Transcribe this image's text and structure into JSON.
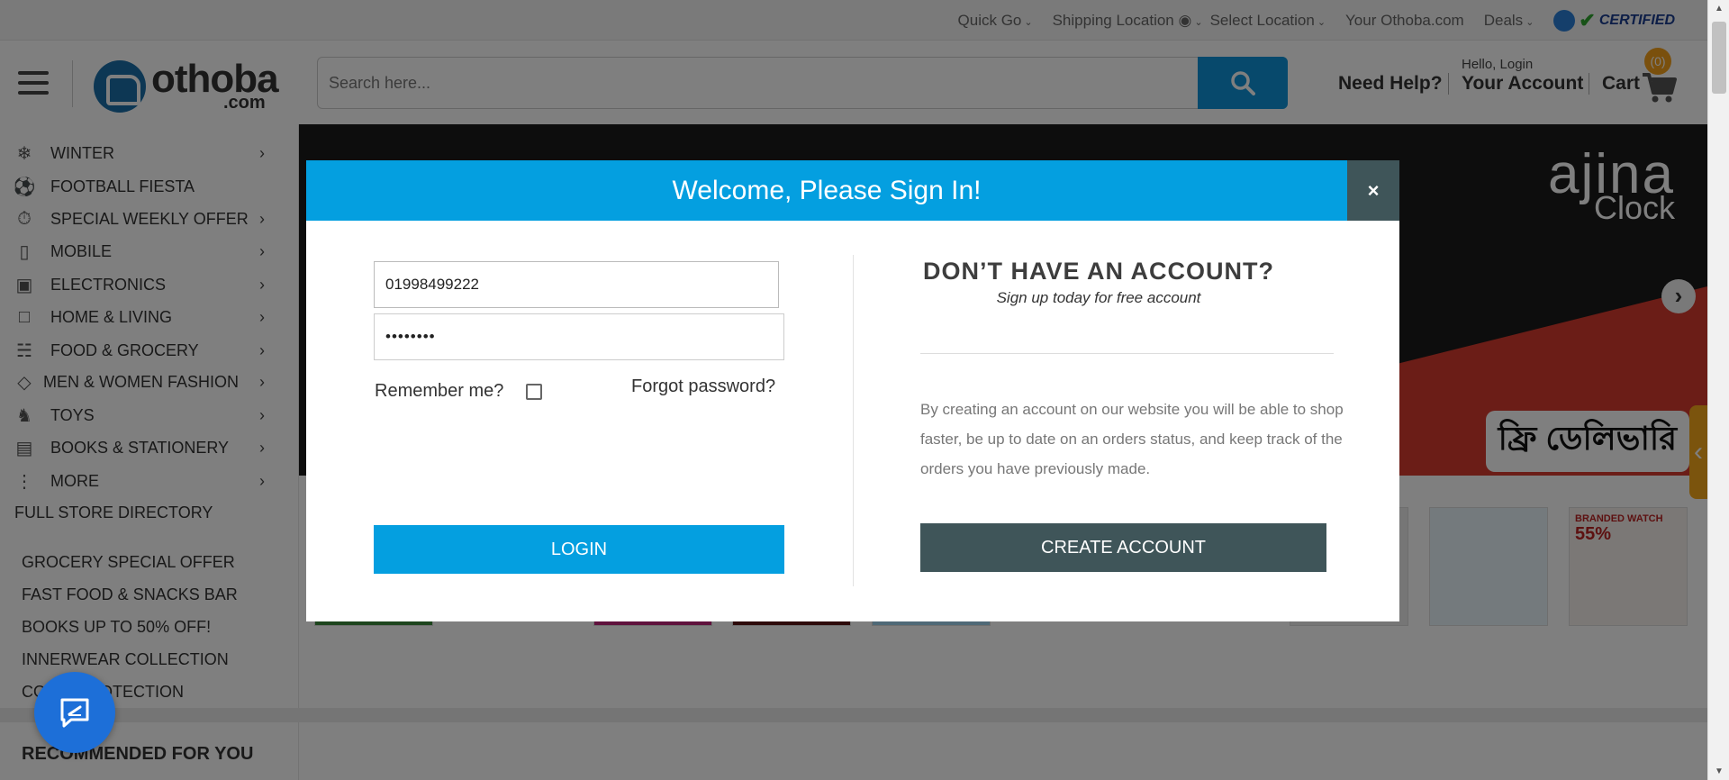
{
  "topbar": {
    "links": [
      "Quick Go",
      "Shipping Location",
      "Select Location",
      "Your Othoba.com",
      "Deals"
    ],
    "certified": "CERTIFIED"
  },
  "header": {
    "logo_main": "othoba",
    "logo_sub": ".com",
    "search_placeholder": "Search here...",
    "need_help": "Need Help?",
    "account_greeting": "Hello, Login",
    "account_label": "Your Account",
    "cart_label": "Cart",
    "cart_count": "(0)"
  },
  "sidebar": {
    "categories": [
      {
        "label": "WINTER",
        "icon": "snowflake-icon"
      },
      {
        "label": "FOOTBALL FIESTA",
        "icon": "football-icon"
      },
      {
        "label": "SPECIAL WEEKLY OFFER",
        "icon": "stopwatch-icon"
      },
      {
        "label": "MOBILE",
        "icon": "mobile-icon"
      },
      {
        "label": "ELECTRONICS",
        "icon": "electronics-icon"
      },
      {
        "label": "HOME & LIVING",
        "icon": "home-icon"
      },
      {
        "label": "FOOD & GROCERY",
        "icon": "basket-icon"
      },
      {
        "label": "MEN & WOMEN FASHION",
        "icon": "diamond-icon"
      },
      {
        "label": "TOYS",
        "icon": "toy-icon"
      },
      {
        "label": "BOOKS & STATIONERY",
        "icon": "book-icon"
      },
      {
        "label": "MORE",
        "icon": "more-dots-icon"
      }
    ],
    "full_store": "FULL STORE DIRECTORY",
    "promos": [
      "GROCERY SPECIAL OFFER",
      "FAST FOOD & SNACKS BAR",
      "BOOKS UP TO 50% OFF!",
      "INNERWEAR COLLECTION",
      "COVID PROTECTION"
    ],
    "recommended": "RECOMMENDED FOR YOU"
  },
  "banner": {
    "brand": "ajina",
    "brand_sub": "Clock",
    "free_delivery": "ফ্রি ডেলিভারি"
  },
  "tiles": {
    "watch_label": "BRANDED WATCH",
    "watch_discount": "55%"
  },
  "modal": {
    "title": "Welcome, Please Sign In!",
    "close": "×",
    "phone_value": "01998499222",
    "password_value": "••••••••",
    "remember_label": "Remember me?",
    "remember_checked": false,
    "forgot_label": "Forgot password?",
    "login_label": "LOGIN",
    "signup_heading": "DON’T HAVE AN ACCOUNT?",
    "signup_sub": "Sign up today for free account",
    "signup_benefits": "By creating an account on our website you will be able to shop faster, be up to date on an orders status, and keep track of the orders you have previously made.",
    "create_label": "CREATE ACCOUNT"
  },
  "colors": {
    "accent_blue": "#049fe0",
    "dark_slate": "#3f5559",
    "cart_badge": "#f5a01a"
  }
}
